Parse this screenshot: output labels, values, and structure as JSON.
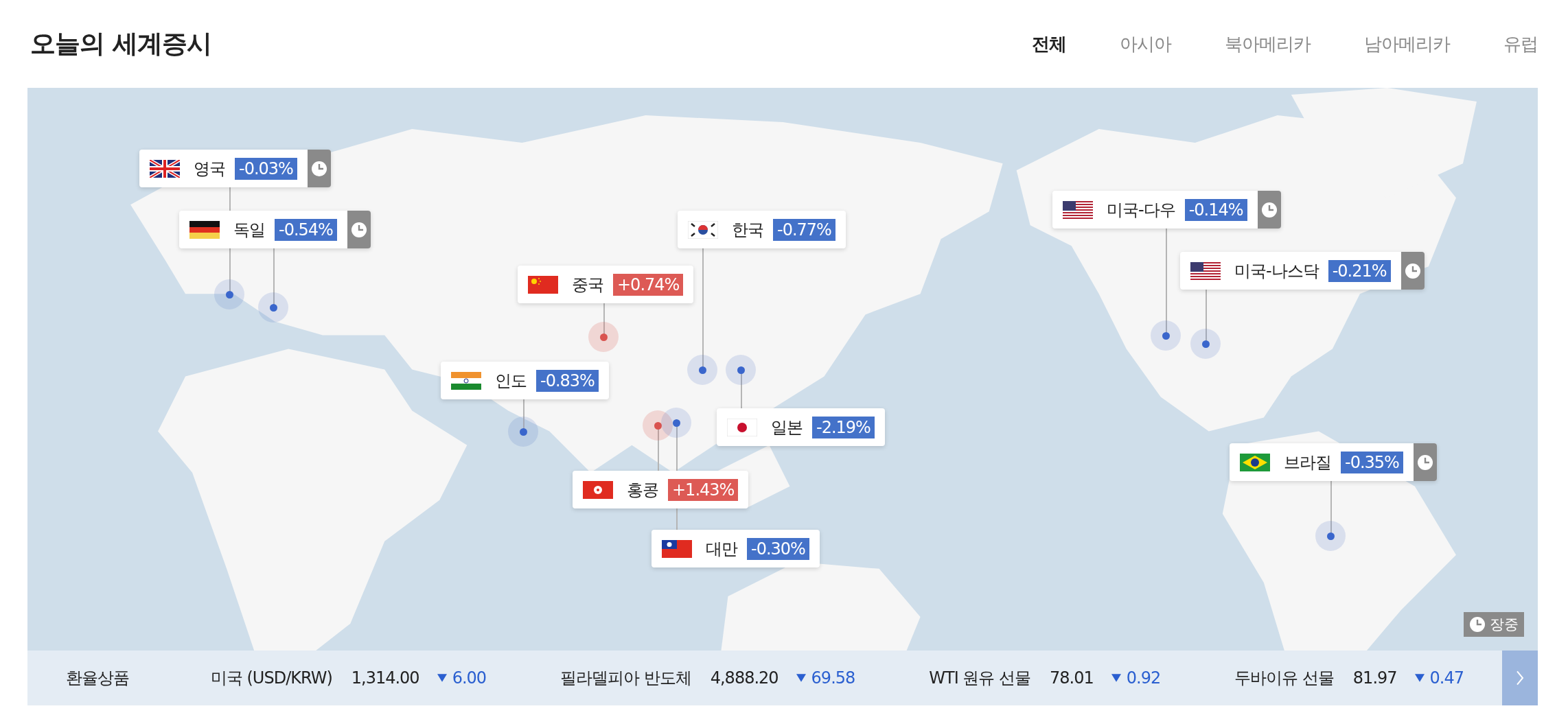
{
  "title": "오늘의 세계증시",
  "tabs": [
    {
      "label": "전체",
      "selected": true
    },
    {
      "label": "아시아",
      "selected": false
    },
    {
      "label": "북아메리카",
      "selected": false
    },
    {
      "label": "남아메리카",
      "selected": false
    },
    {
      "label": "유럽",
      "selected": false
    }
  ],
  "markers": [
    {
      "name": "영국",
      "change": "-0.03%",
      "rising": false,
      "clock": true
    },
    {
      "name": "독일",
      "change": "-0.54%",
      "rising": false,
      "clock": true
    },
    {
      "name": "한국",
      "change": "-0.77%",
      "rising": false,
      "clock": false
    },
    {
      "name": "중국",
      "change": "+0.74%",
      "rising": true,
      "clock": false
    },
    {
      "name": "인도",
      "change": "-0.83%",
      "rising": false,
      "clock": false
    },
    {
      "name": "일본",
      "change": "-2.19%",
      "rising": false,
      "clock": false
    },
    {
      "name": "홍콩",
      "change": "+1.43%",
      "rising": true,
      "clock": false
    },
    {
      "name": "대만",
      "change": "-0.30%",
      "rising": false,
      "clock": false
    },
    {
      "name": "미국-다우",
      "change": "-0.14%",
      "rising": false,
      "clock": true
    },
    {
      "name": "미국-나스닥",
      "change": "-0.21%",
      "rising": false,
      "clock": true
    },
    {
      "name": "브라질",
      "change": "-0.35%",
      "rising": false,
      "clock": true
    }
  ],
  "legend": "장중",
  "ticker": {
    "label": "환율상품",
    "items": [
      {
        "name": "미국 (USD/KRW)",
        "value": "1,314.00",
        "change": "6.00",
        "rising": false
      },
      {
        "name": "필라델피아 반도체",
        "value": "4,888.20",
        "change": "69.58",
        "rising": false
      },
      {
        "name": "WTI 원유 선물",
        "value": "78.01",
        "change": "0.92",
        "rising": false
      },
      {
        "name": "두바이유 선물",
        "value": "81.97",
        "change": "0.47",
        "rising": false
      }
    ]
  }
}
